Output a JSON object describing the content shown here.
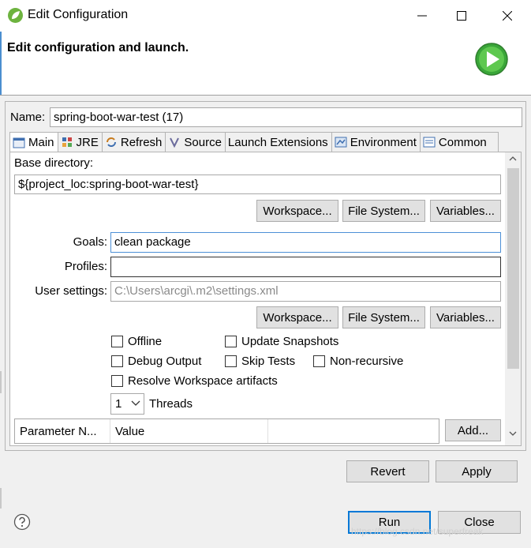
{
  "window": {
    "title": "Edit Configuration",
    "header_title": "Edit configuration and launch."
  },
  "name": {
    "label": "Name:",
    "value": "spring-boot-war-test (17)"
  },
  "tabs": [
    {
      "label": "Main",
      "icon": "main-tab-icon"
    },
    {
      "label": "JRE",
      "icon": "jre-icon"
    },
    {
      "label": "Refresh",
      "icon": "refresh-icon"
    },
    {
      "label": "Source",
      "icon": "source-icon"
    },
    {
      "label": "Launch Extensions",
      "icon": ""
    },
    {
      "label": "Environment",
      "icon": "environment-icon"
    },
    {
      "label": "Common",
      "icon": "common-icon"
    }
  ],
  "main": {
    "base_directory_label": "Base directory:",
    "base_directory_value": "${project_loc:spring-boot-war-test}",
    "workspace_button": "Workspace...",
    "file_system_button": "File System...",
    "variables_button": "Variables...",
    "goals_label": "Goals:",
    "goals_value": "clean package",
    "profiles_label": "Profiles:",
    "profiles_value": "",
    "user_settings_label": "User settings:",
    "user_settings_value": "C:\\Users\\arcgi\\.m2\\settings.xml",
    "checkboxes": {
      "offline": "Offline",
      "update_snapshots": "Update Snapshots",
      "debug_output": "Debug Output",
      "skip_tests": "Skip Tests",
      "non_recursive": "Non-recursive",
      "resolve_workspace": "Resolve Workspace artifacts"
    },
    "threads_value": "1",
    "threads_label": "Threads",
    "table": {
      "col_name": "Parameter N...",
      "col_value": "Value"
    },
    "add_button": "Add..."
  },
  "buttons": {
    "revert": "Revert",
    "apply": "Apply",
    "run": "Run",
    "close": "Close"
  },
  "watermark": "https://blog.csdn.net/superfreak",
  "colors": {
    "accent": "#0078d7",
    "run_green": "#3aa639"
  }
}
